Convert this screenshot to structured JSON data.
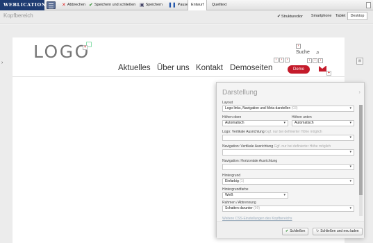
{
  "app": {
    "brand": "WEBLICATION®"
  },
  "toolbar": {
    "abbrechen": "Abbrechen",
    "speichern_schliessen": "Speichern und schließen",
    "speichern": "Speichern",
    "pause": "Pause",
    "entwurf": "Entwurf",
    "quelltext": "Quelltext"
  },
  "subbar": {
    "title": "Kopfbereich",
    "strukturedit": "Strukturedior",
    "smartphone": "Smartphone",
    "tablet": "Tablet",
    "desktop": "Desktop"
  },
  "header": {
    "logo": "LOGO",
    "nav": [
      "Aktuelles",
      "Über uns",
      "Kontakt",
      "Demoseiten"
    ],
    "search_label": "Suche",
    "demo_button": "Demo"
  },
  "panel": {
    "title": "Darstellung",
    "layout_label": "Layout",
    "layout_value": "Logo links, Navigation und Meta darstellen",
    "layout_hint": "(03)",
    "hoehe_oben_label": "Höhen oben",
    "hoehe_oben_value": "Automatisch",
    "hoehe_unten_label": "Höhen unten",
    "hoehe_unten_value": "Automatisch",
    "logo_vert_label": "Logo: Vertikale Ausrichtung",
    "logo_vert_hint": "Ggf. nur bei definierter Höhe möglich",
    "nav_vert_label": "Navigation: Vertikale Ausrichtung",
    "nav_vert_hint": "Ggf. nur bei definierter Höhe möglich",
    "nav_horiz_label": "Navigation: Horizontale Ausrichtung",
    "hintergrund_label": "Hintergrund",
    "hintergrund_value": "Einfarbig",
    "hintergrund_hint": "(1)",
    "hintergrundfarbe_label": "Hintergrundfarbe",
    "hintergrundfarbe_value": "Weiß",
    "rahmen_label": "Rahmen / Abtrennung",
    "rahmen_value": "Schatten darunter",
    "rahmen_hint": "(09)",
    "more_link": "Weitere CSS-Einstellungen des Kopfbereichs",
    "close_button": "Schließen",
    "close_reload_button": "Schließen und neu laden"
  },
  "colors": {
    "brand_bar": "#1e3c72",
    "accent_red": "#c41a2a"
  }
}
